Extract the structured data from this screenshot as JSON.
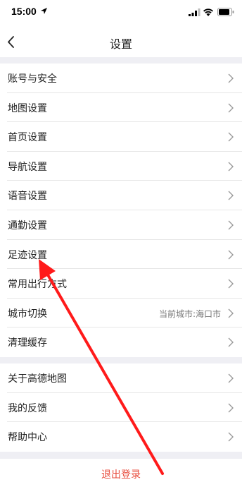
{
  "status_bar": {
    "time": "15:00",
    "icons": [
      "location-arrow-icon",
      "signal-icon",
      "wifi-icon",
      "battery-icon"
    ]
  },
  "nav": {
    "title": "设置",
    "back_icon": "chevron-left-icon"
  },
  "sections": [
    {
      "items": [
        {
          "label": "账号与安全"
        },
        {
          "label": "地图设置"
        },
        {
          "label": "首页设置"
        },
        {
          "label": "导航设置"
        },
        {
          "label": "语音设置"
        },
        {
          "label": "通勤设置"
        },
        {
          "label": "足迹设置"
        },
        {
          "label": "常用出行方式"
        },
        {
          "label": "城市切换",
          "value": "当前城市:海口市"
        },
        {
          "label": "清理缓存"
        }
      ]
    },
    {
      "items": [
        {
          "label": "关于高德地图"
        },
        {
          "label": "我的反馈"
        },
        {
          "label": "帮助中心"
        }
      ]
    }
  ],
  "logout": {
    "label": "退出登录"
  },
  "colors": {
    "background": "#efeff4",
    "logout_text": "#e84c3d",
    "annotation_arrow": "#ff1a1a"
  }
}
